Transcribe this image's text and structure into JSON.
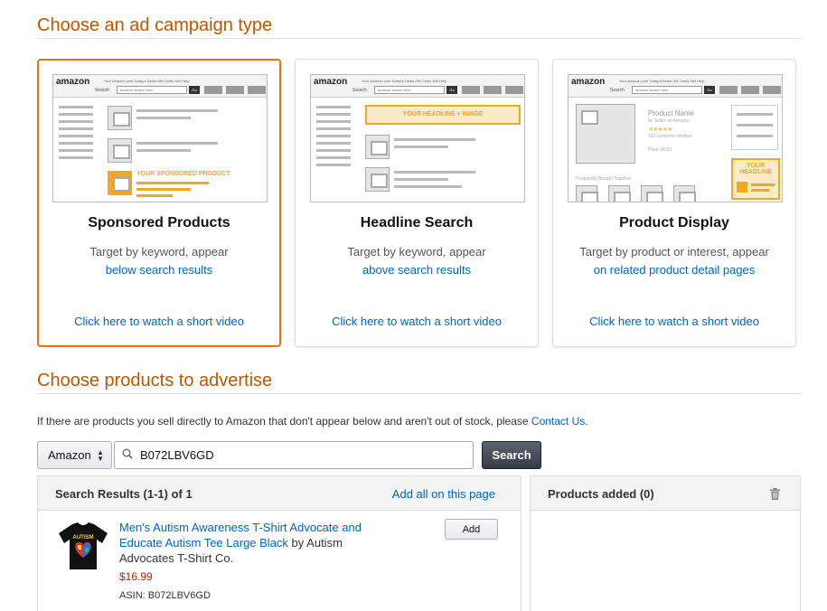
{
  "section1": {
    "title": "Choose an ad campaign type"
  },
  "cards": [
    {
      "title": "Sponsored Products",
      "desc": "Target by keyword, appear",
      "desc_link": "below search results",
      "video": "Click here to watch a short video",
      "mock_label": "YOUR SPONSORED PRODUCT"
    },
    {
      "title": "Headline Search",
      "desc": "Target by keyword, appear",
      "desc_link": "above search results",
      "video": "Click here to watch a short video",
      "mock_label": "YOUR HEADLINE + IMAGE"
    },
    {
      "title": "Product Display",
      "desc": "Target by product or interest, appear",
      "desc_link": "on related product detail pages",
      "video": "Click here to watch a short video",
      "mock_label1": "YOUR",
      "mock_label2": "HEADLINE",
      "mock_product_name": "Product Name",
      "mock_by": "by Seller on Amazon",
      "mock_reviews": "732 customer reviews",
      "mock_price": "Price: $0.81",
      "mock_fbt": "Frequently Bought Together"
    }
  ],
  "mock": {
    "logo": "amazon",
    "nav": "Your Amazon.com   Today's Deals   Gift Cards   Sell   Help",
    "search_label": "Search",
    "search_text": "amazon search term",
    "go": "Go"
  },
  "section2": {
    "title": "Choose products to advertise",
    "info": "If there are products you sell directly to Amazon that don't appear below and aren't out of stock, please ",
    "contact_link": "Contact Us",
    "period": "."
  },
  "search": {
    "marketplace": "Amazon",
    "query": "B072LBV6GD",
    "button": "Search"
  },
  "results": {
    "title": "Search Results (1-1) of 1",
    "add_all": "Add all on this page",
    "item": {
      "title": "Men's Autism Awareness T-Shirt Advocate and Educate Autism Tee Large Black",
      "by": " by Autism Advocates T-Shirt Co.",
      "price": "$16.99",
      "asin": "ASIN: B072LBV6GD",
      "add": "Add",
      "shirt_text": "AUTISM"
    }
  },
  "added": {
    "title": "Products added (0)"
  },
  "colors": {
    "accent": "#c45500",
    "link": "#0066c0",
    "selected_border": "#e77600",
    "price": "#b12704",
    "mock_orange": "#f5a623"
  }
}
